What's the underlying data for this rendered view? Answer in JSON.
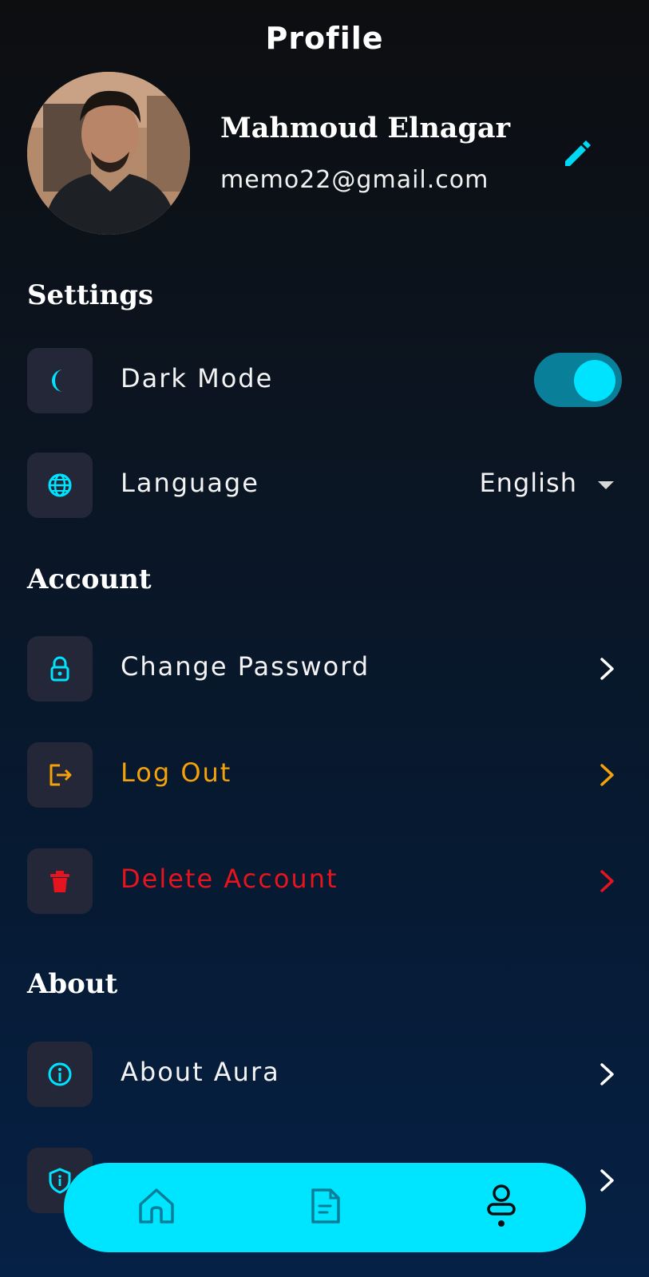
{
  "header": {
    "title": "Profile"
  },
  "profile": {
    "name": "Mahmoud Elnagar",
    "email": "memo22@gmail.com"
  },
  "sections": {
    "settings": {
      "title": "Settings",
      "dark_mode": {
        "label": "Dark Mode",
        "enabled": true
      },
      "language": {
        "label": "Language",
        "value": "English"
      }
    },
    "account": {
      "title": "Account",
      "change_password": {
        "label": "Change Password"
      },
      "log_out": {
        "label": "Log Out"
      },
      "delete_account": {
        "label": "Delete Account"
      }
    },
    "about": {
      "title": "About",
      "about_aura": {
        "label": "About Aura"
      }
    }
  },
  "nav": {
    "items": [
      "home-icon",
      "document-icon",
      "profile-icon"
    ],
    "active": "profile-icon"
  },
  "colors": {
    "accent": "#00e5ff",
    "logout": "#f4a10c",
    "danger": "#e6141e",
    "icon_box": "#242737",
    "toggle_track": "#0a7f9a"
  }
}
